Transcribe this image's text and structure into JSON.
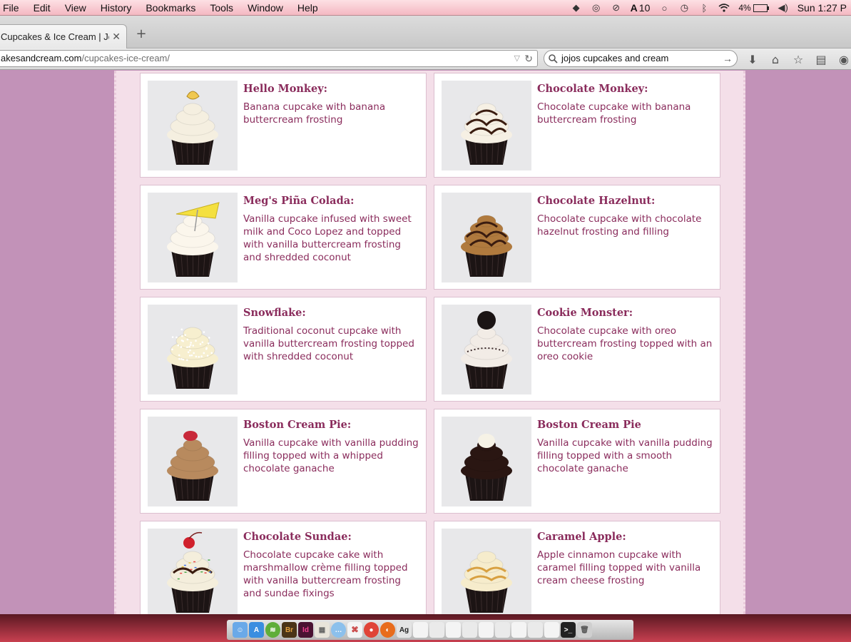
{
  "menubar": {
    "items": [
      "File",
      "Edit",
      "View",
      "History",
      "Bookmarks",
      "Tools",
      "Window",
      "Help"
    ],
    "status": {
      "adobe_count": "10",
      "battery": "4%",
      "clock": "Sun 1:27 P"
    }
  },
  "tab": {
    "title": "Cupcakes & Ice Cream | Jo...",
    "close": "✕",
    "new_tab": "+"
  },
  "navbar": {
    "url_domain": "akesandcream.com",
    "url_path": "/cupcakes-ice-cream/",
    "search_value": "jojos cupcakes and cream"
  },
  "cupcakes": [
    {
      "name": "Hello Monkey:",
      "desc": "Banana cupcake with banana buttercream frosting",
      "frosting": "#f5efe0",
      "topping": "banana"
    },
    {
      "name": "Chocolate Monkey:",
      "desc": "Chocolate cupcake with banana buttercream frosting",
      "frosting": "#f6f0e4",
      "topping": "choc-drizzle"
    },
    {
      "name": "Meg's Piña Colada:",
      "desc": "Vanilla cupcake infused with sweet milk and Coco Lopez and topped with vanilla buttercream frosting and shredded coconut",
      "frosting": "#fbf6ec",
      "topping": "umbrella"
    },
    {
      "name": "Chocolate Hazelnut:",
      "desc": "Chocolate cupcake with chocolate hazelnut frosting and filling",
      "frosting": "#b07a3e",
      "topping": "choc-drizzle"
    },
    {
      "name": "Snowflake:",
      "desc": "Traditional coconut cupcake with vanilla buttercream frosting topped with shredded coconut",
      "frosting": "#f7efcf",
      "topping": "coconut"
    },
    {
      "name": "Cookie Monster:",
      "desc": "Chocolate cupcake with oreo buttercream frosting topped with an oreo cookie",
      "frosting": "#f2ece6",
      "topping": "oreo"
    },
    {
      "name": "Boston Cream Pie:",
      "desc": "Vanilla cupcake with vanilla pudding filling topped with a whipped chocolate ganache",
      "frosting": "#b88a5e",
      "topping": "cherry"
    },
    {
      "name": "Boston Cream Pie",
      "desc": "Vanilla cupcake with vanilla pudding filling topped with a smooth chocolate ganache",
      "frosting": "#2a1612",
      "topping": "cream"
    },
    {
      "name": "Chocolate Sundae:",
      "desc": "Chocolate cupcake cake with marshmallow crème filling topped with vanilla buttercream frosting and sundae fixings",
      "frosting": "#f4eedc",
      "topping": "cherry-sprinkles"
    },
    {
      "name": "Caramel Apple:",
      "desc": "Apple cinnamon cupcake with caramel filling topped with vanilla cream cheese frosting",
      "frosting": "#f6eccc",
      "topping": "caramel"
    }
  ],
  "colors": {
    "accent": "#8a2c5c",
    "page_bg": "#c292b8",
    "panel_bg": "#f4dfe9"
  }
}
